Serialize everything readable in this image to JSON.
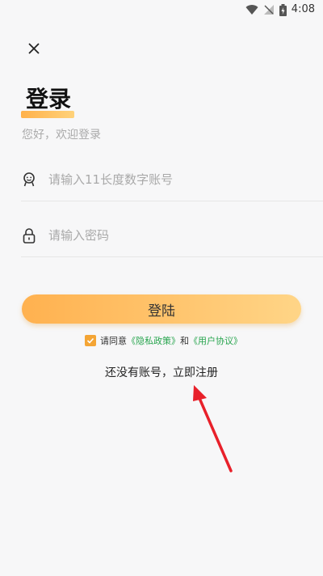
{
  "status_bar": {
    "time": "4:08"
  },
  "header": {
    "close_icon": "close-icon",
    "title": "登录",
    "subtitle": "您好，欢迎登录"
  },
  "form": {
    "phone": {
      "icon": "user-icon",
      "value": "",
      "placeholder": "请输入11长度数字账号"
    },
    "password": {
      "icon": "lock-icon",
      "value": "",
      "placeholder": "请输入密码"
    },
    "login_label": "登陆"
  },
  "agreement": {
    "checked": true,
    "prefix": "请同意",
    "privacy_link": "《隐私政策》",
    "conjunction": "和",
    "terms_link": "《用户协议》"
  },
  "register": {
    "label": "还没有账号，立即注册"
  },
  "colors": {
    "accent_start": "#ffb14f",
    "accent_end": "#ffd587",
    "checkbox": "#f4a535",
    "link_green": "#29a54f",
    "arrow_red": "#e8202a"
  }
}
